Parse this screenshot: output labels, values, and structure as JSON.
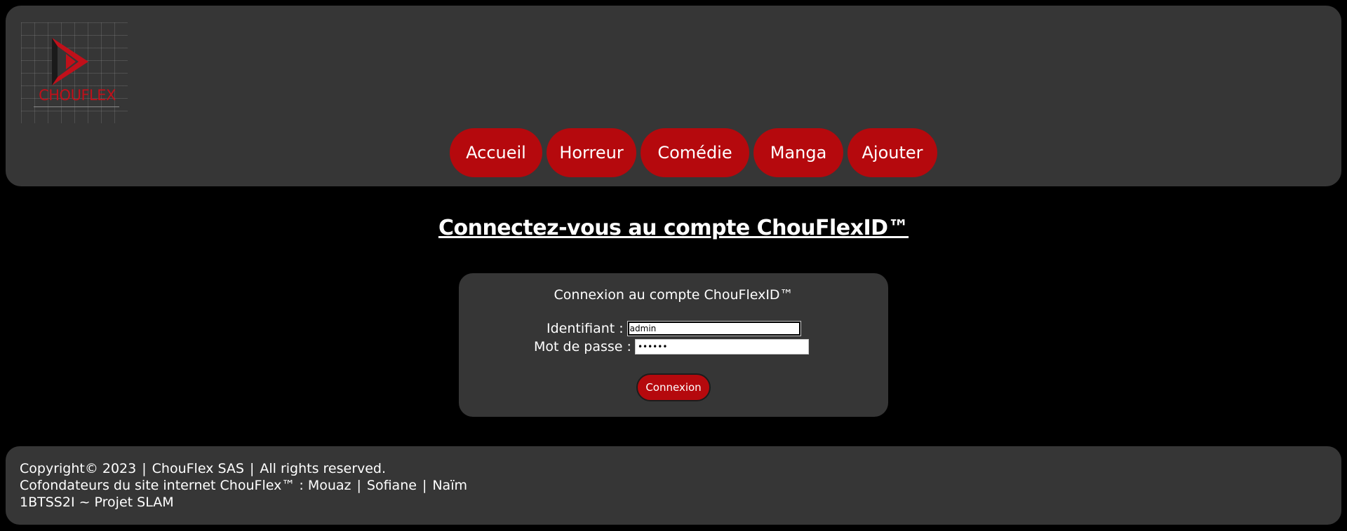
{
  "logo": {
    "text": "CHOUFLEX"
  },
  "nav": {
    "items": [
      "Accueil",
      "Horreur",
      "Comédie",
      "Manga",
      "Ajouter"
    ]
  },
  "page_title": "Connectez-vous au compte ChouFlexID™",
  "login": {
    "heading": "Connexion au compte ChouFlexID™",
    "username_label": "Identifiant :",
    "username_value": "admin",
    "password_label": "Mot de passe :",
    "password_value": "••••••",
    "submit_label": "Connexion"
  },
  "footer": {
    "line1": [
      "Copyright© 2023",
      "ChouFlex SAS",
      "All rights reserved."
    ],
    "line2_prefix": "Cofondateurs du site internet ChouFlex™ : ",
    "founders": [
      "Mouaz",
      "Sofiane",
      "Naïm"
    ],
    "line3": "1BTSS2I ~ Projet SLAM",
    "separator": "|"
  },
  "colors": {
    "background": "#000000",
    "panel": "#363636",
    "accent": "#b5090d",
    "text": "#ffffff"
  }
}
